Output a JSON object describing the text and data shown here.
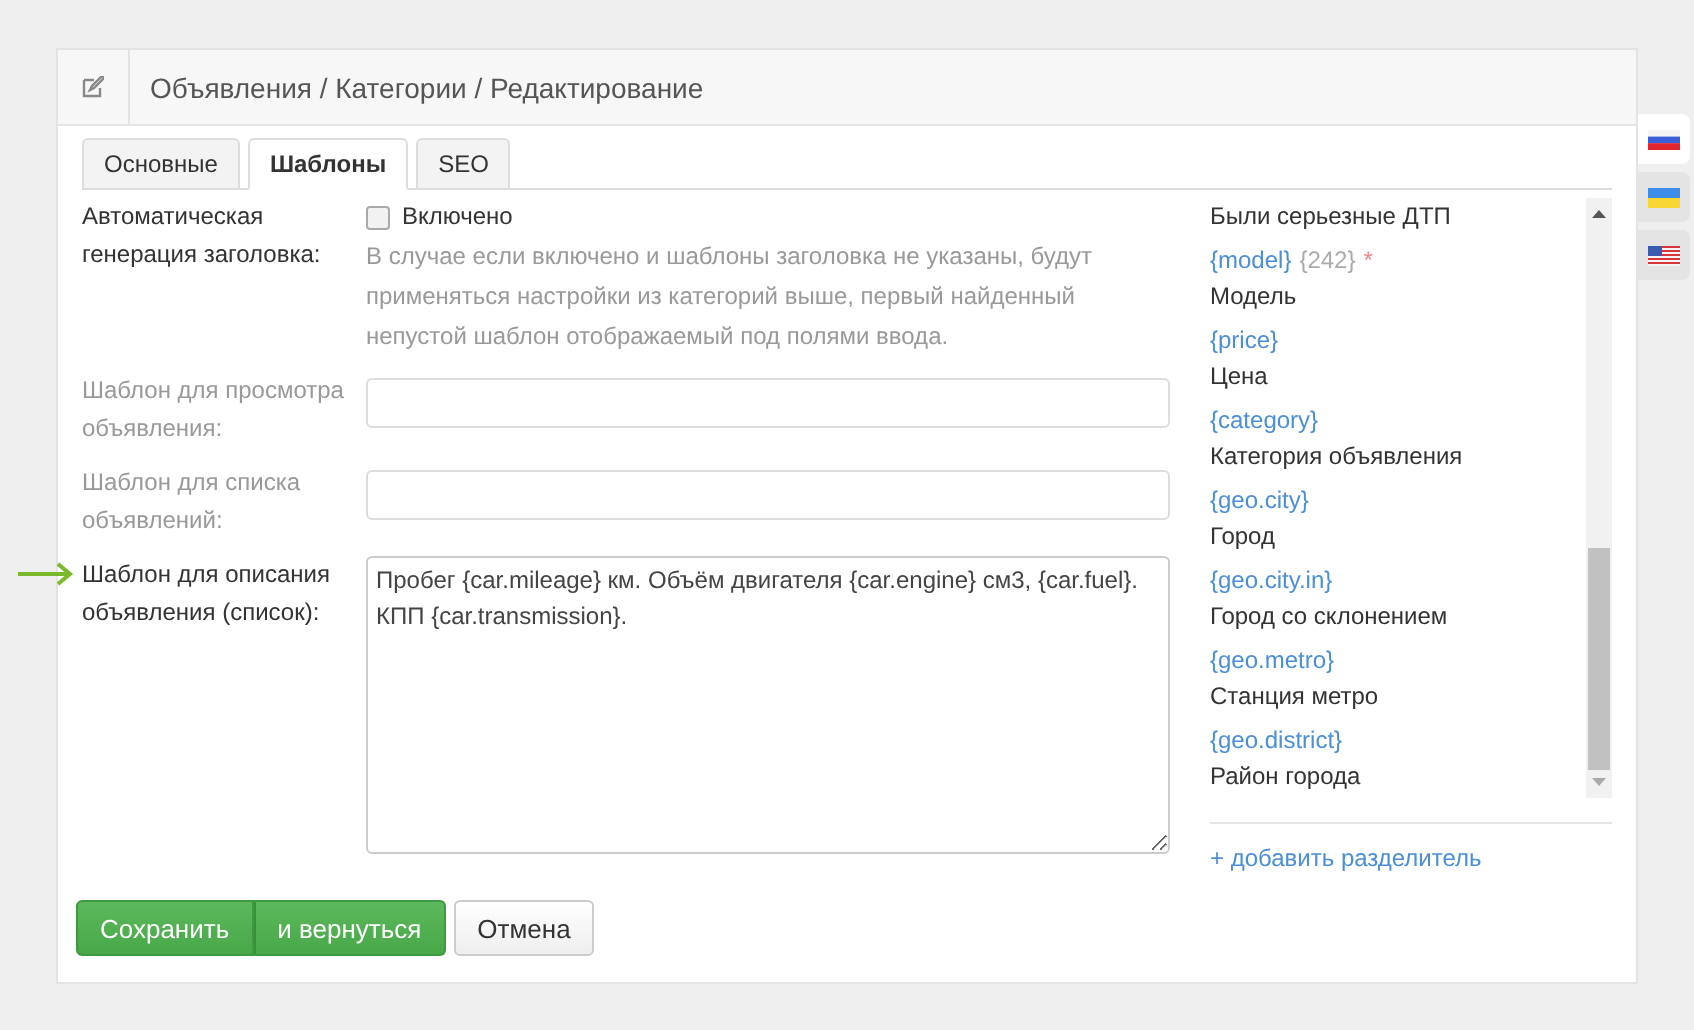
{
  "header": {
    "title": "Объявления / Категории / Редактирование"
  },
  "tabs": [
    {
      "label": "Основные",
      "selected": false
    },
    {
      "label": "Шаблоны",
      "selected": true
    },
    {
      "label": "SEO",
      "selected": false
    }
  ],
  "auto_title": {
    "label": "Автоматическая генерация заголовка:",
    "checkbox_label": "Включено",
    "checked": false,
    "hint": "В случае если включено и шаблоны заголовка не указаны, будут применяться настройки из категорий выше, первый найденный непустой шаблон отображаемый под полями ввода."
  },
  "fields": [
    {
      "label": "Шаблон для просмотра объявления:",
      "kind": "input",
      "muted": true,
      "pointed": false
    },
    {
      "label": "Шаблон для списка объявлений:",
      "kind": "input",
      "muted": true,
      "pointed": false
    },
    {
      "label": "Шаблон для описания объявления (список):",
      "kind": "textarea",
      "muted": false,
      "pointed": true,
      "value": "Пробег {car.mileage} км. Объём двигателя {car.engine} см3, {car.fuel}. КПП {car.transmission}."
    }
  ],
  "macros": [
    {
      "description": "Были серьезные ДТП"
    },
    {
      "tag": "{model}",
      "extra": "{242}",
      "mark": "*",
      "description": "Модель"
    },
    {
      "tag": "{price}",
      "description": "Цена"
    },
    {
      "tag": "{category}",
      "description": "Категория объявления"
    },
    {
      "tag": "{geo.city}",
      "description": "Город"
    },
    {
      "tag": "{geo.city.in}",
      "description": "Город со склонением"
    },
    {
      "tag": "{geo.metro}",
      "description": "Станция метро"
    },
    {
      "tag": "{geo.district}",
      "description": "Район города"
    }
  ],
  "add_separator": "+ добавить разделитель",
  "buttons": {
    "save": "Сохранить",
    "save_return": "и вернуться",
    "cancel": "Отмена"
  },
  "languages": [
    {
      "kind": "ru",
      "selected": true
    },
    {
      "kind": "ua",
      "selected": false
    },
    {
      "kind": "us",
      "selected": false
    }
  ]
}
